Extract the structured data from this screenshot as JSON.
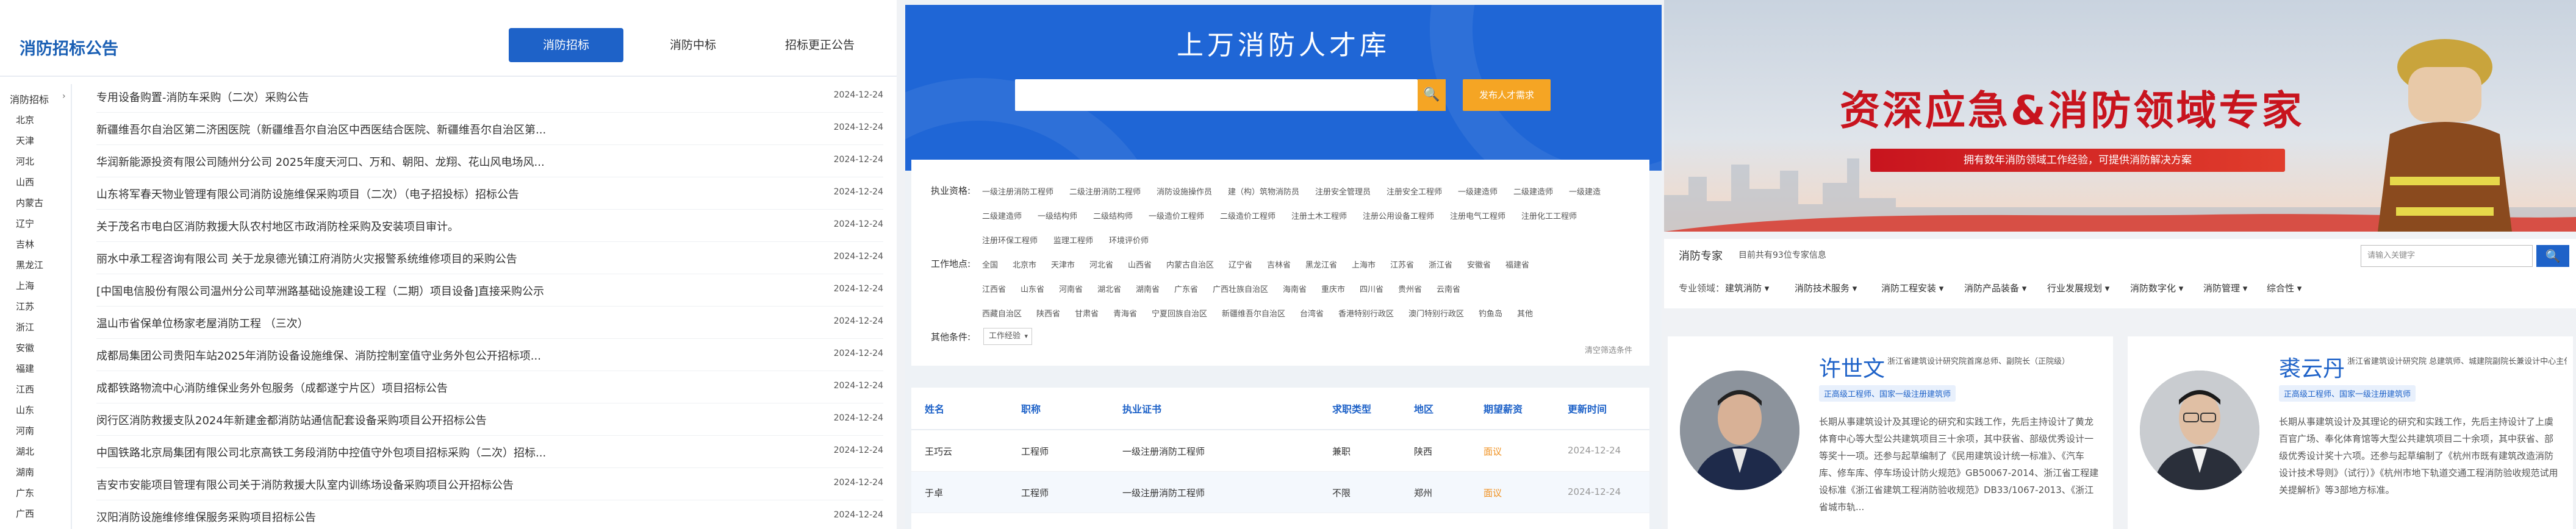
{
  "tender": {
    "title": "消防招标公告",
    "tabs": [
      "消防招标",
      "消防中标",
      "招标更正公告"
    ],
    "side_top": "消防招标",
    "regions": [
      "北京",
      "天津",
      "河北",
      "山西",
      "内蒙古",
      "辽宁",
      "吉林",
      "黑龙江",
      "上海",
      "江苏",
      "浙江",
      "安徽",
      "福建",
      "江西",
      "山东",
      "河南",
      "湖北",
      "湖南",
      "广东",
      "广西"
    ],
    "rows": [
      {
        "t": "专用设备购置-消防车采购（二次）采购公告",
        "d": "2024-12-24"
      },
      {
        "t": "新疆维吾尔自治区第二济困医院（新疆维吾尔自治区中西医结合医院、新疆维吾尔自治区第...",
        "d": "2024-12-24"
      },
      {
        "t": "华润新能源投资有限公司随州分公司 2025年度天河口、万和、朝阳、龙翔、花山风电场风...",
        "d": "2024-12-24"
      },
      {
        "t": "山东将军春天物业管理有限公司消防设施维保采购项目（二次）（电子招投标）招标公告",
        "d": "2024-12-24"
      },
      {
        "t": "关于茂名市电白区消防救援大队农村地区市政消防栓采购及安装项目审计。",
        "d": "2024-12-24"
      },
      {
        "t": "丽水中承工程咨询有限公司 关于龙泉德光镇江府消防火灾报警系统维修项目的采购公告",
        "d": "2024-12-24"
      },
      {
        "t": "[中国电信股份有限公司温州分公司苹洲路基础设施建设工程（二期）项目设备]直接采购公示",
        "d": "2024-12-24"
      },
      {
        "t": "温山市省保单位杨家老屋消防工程 （三次）",
        "d": "2024-12-24"
      },
      {
        "t": "成都局集团公司贵阳车站2025年消防设备设施维保、消防控制室值守业务外包公开招标项...",
        "d": "2024-12-24"
      },
      {
        "t": "成都铁路物流中心消防维保业务外包服务（成都遂宁片区）项目招标公告",
        "d": "2024-12-24"
      },
      {
        "t": "闵行区消防救援支队2024年新建金都消防站通信配套设备采购项目公开招标公告",
        "d": "2024-12-24"
      },
      {
        "t": "中国铁路北京局集团有限公司北京高铁工务段消防中控值守外包项目招标采购（二次）招标...",
        "d": "2024-12-24"
      },
      {
        "t": "吉安市安能项目管理有限公司关于消防救援大队室内训练场设备采购项目公开招标公告",
        "d": "2024-12-24"
      }
    ],
    "partial_row": {
      "t": "汉阳消防设施维修维保服务采购项目招标公告",
      "d": "2024-12-24"
    }
  },
  "talent": {
    "title": "上万消防人才库",
    "search_icon": "🔍",
    "post_btn": "发布人才需求",
    "filter_labels": [
      "执业资格:",
      "工作地点:",
      "其他条件:"
    ],
    "qual_row1": [
      "一级注册消防工程师",
      "二级注册消防工程师",
      "消防设施操作员",
      "建（构）筑物消防员",
      "注册安全管理员",
      "注册安全工程师",
      "一级建造师",
      "二级建造师",
      "一级建造"
    ],
    "qual_row2": [
      "二级建造师",
      "一级结构师",
      "二级结构师",
      "一级造价工程师",
      "二级造价工程师",
      "注册土木工程师",
      "注册公用设备工程师",
      "注册电气工程师",
      "注册化工工程师"
    ],
    "qual_row3": [
      "注册环保工程师",
      "监理工程师",
      "环境评价师"
    ],
    "loc_row1": [
      "全国",
      "北京市",
      "天津市",
      "河北省",
      "山西省",
      "内蒙古自治区",
      "辽宁省",
      "吉林省",
      "黑龙江省",
      "上海市",
      "江苏省",
      "浙江省",
      "安徽省",
      "福建省"
    ],
    "loc_row2": [
      "江西省",
      "山东省",
      "河南省",
      "湖北省",
      "湖南省",
      "广东省",
      "广西壮族自治区",
      "海南省",
      "重庆市",
      "四川省",
      "贵州省",
      "云南省"
    ],
    "loc_row3": [
      "西藏自治区",
      "陕西省",
      "甘肃省",
      "青海省",
      "宁夏回族自治区",
      "新疆维吾尔自治区",
      "台湾省",
      "香港特别行政区",
      "澳门特别行政区",
      "钓鱼岛",
      "其他"
    ],
    "other_select": "工作经验",
    "clear": "清空筛选条件",
    "columns": [
      "姓名",
      "职称",
      "执业证书",
      "求职类型",
      "地区",
      "期望薪资",
      "更新时间"
    ],
    "rows": [
      {
        "name": "王巧云",
        "title": "工程师",
        "cert": "一级注册消防工程师",
        "type": "兼职",
        "area": "陕西",
        "salary": "面议",
        "date": "2024-12-24"
      },
      {
        "name": "于卓",
        "title": "工程师",
        "cert": "一级注册消防工程师",
        "type": "不限",
        "area": "郑州",
        "salary": "面议",
        "date": "2024-12-24"
      }
    ]
  },
  "experts": {
    "banner_title": "资深应急&消防领域专家",
    "banner_ribbon": "拥有数年消防领域工作经验，可提供消防解决方案",
    "nav_title": "消防专家",
    "nav_sub": "目前共有93位专家信息",
    "search_placeholder": "请输入关键字",
    "search_icon": "🔍",
    "nav_label": "专业领域：",
    "nav_items": [
      "建筑消防",
      "消防技术服务",
      "消防工程安装",
      "消防产品装备",
      "行业发展规划",
      "消防数字化",
      "消防管理",
      "综合性"
    ],
    "cards": [
      {
        "name": "许世文",
        "sub": "浙江省建筑设计研究院首席总师、副院长（正院级）",
        "tags": "正高级工程师、国家一级注册建筑师",
        "desc": "长期从事建筑设计及其理论的研究和实践工作，先后主持设计了黄龙体育中心等大型公共建筑项目三十余项，其中获省、部级优秀设计一等奖十一项。还参与起草编制了《民用建筑设计统一标准》、《汽车库、修车库、停车场设计防火规范》GB50067-2014、浙江省工程建设标准《浙江省建筑工程消防验收规范》DB33/1067-2013、《浙江省城市轨..."
      },
      {
        "name": "裘云丹",
        "sub": "浙江省建筑设计研究院 总建筑师、城建院副院长兼设计中心主任",
        "tags": "正高级工程师、国家一级注册建筑师",
        "desc": "长期从事建筑设计及其理论的研究和实践工作，先后主持设计了上虞百官广场、奉化体育馆等大型公共建筑项目二十余项，其中获省、部级优秀设计奖十六项。还参与起草编制了《杭州市既有建筑改造消防设计技术导则》（试行）》《杭州市地下轨道交通工程消防验收规范试用关提解析》等3部地方标准。"
      }
    ]
  }
}
